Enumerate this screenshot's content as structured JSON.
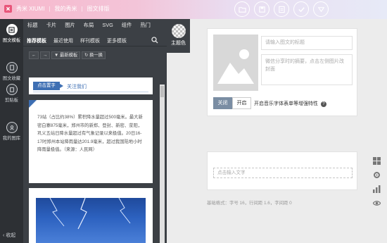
{
  "brand": {
    "name": "秀米 XIUMI",
    "crumb_1": "我的秀米",
    "crumb_2": "图文排版"
  },
  "sidenav": {
    "items": [
      {
        "label": "图文模板",
        "icon": "article-template-icon"
      },
      {
        "label": "图文收藏",
        "icon": "favorites-icon"
      },
      {
        "label": "剪贴板",
        "icon": "clipboard-icon"
      },
      {
        "label": "我的图库",
        "icon": "gallery-icon"
      }
    ],
    "collapse": "收起"
  },
  "panel": {
    "tabs_top": [
      "标题",
      "卡片",
      "图片",
      "布局",
      "SVG",
      "组件",
      "热门"
    ],
    "tabs_sub": [
      "推荐模板",
      "最近使用",
      "样刊模板",
      "更多模板"
    ],
    "theme_label": "主题色",
    "toolbar": {
      "filter": "最新模板",
      "shuffle": "换一换"
    }
  },
  "templates": {
    "card1": {
      "pill": "点击置字",
      "follow": "关注我们"
    },
    "card2": {
      "text": "73站（占比约38%）累积降水量超过500毫米。最大新密白寨875毫米，郑州市的新郑、登封、新密、荥阳，巩义五站日降水量超过有气象记录以来极值。20日16-17时郑州本站降雨量达201.9毫米，超过我国陆地小时降雨量极值。（来源：人民网）"
    }
  },
  "editor": {
    "title_placeholder": "请输入图文的标题",
    "desc_placeholder": "微信分享时的摘要，点击左侧图片改封面",
    "toggle_off": "关闭",
    "toggle_on": "开启",
    "music_label": "开启音乐字体表单等增强特性",
    "body_placeholder": "点击输入文字",
    "base_style": "基础格式：字号 16，行间距 1.6，字间距 0"
  },
  "colors": {
    "accent": "#3e6fb3",
    "sidebar": "#2d3034",
    "panel": "#3c4045",
    "brand_pink": "#e8567a"
  }
}
